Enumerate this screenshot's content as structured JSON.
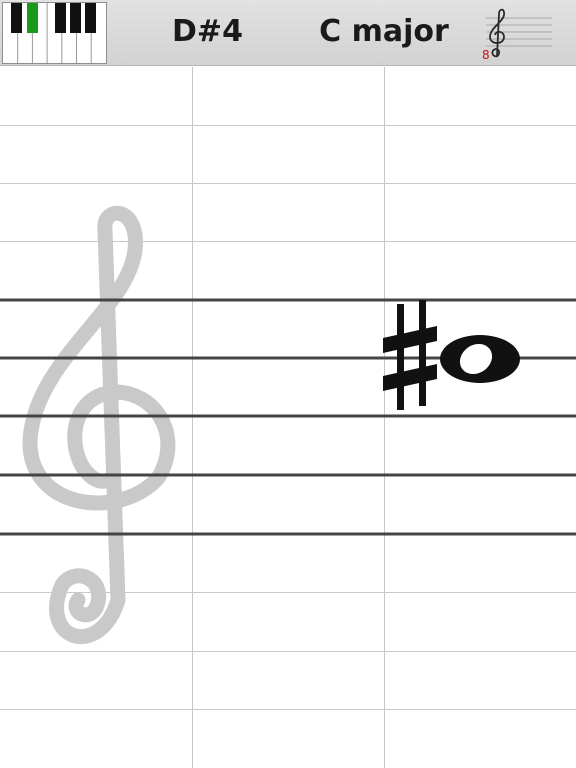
{
  "header": {
    "note": "D#4",
    "key": "C major",
    "clef_octave_marker": "8"
  },
  "keyboard_icon": {
    "name": "piano-keyboard-icon",
    "highlight_color": "#1a9a1a"
  },
  "clef_selector_icon": "treble-clef-icon",
  "staff": {
    "clef": "treble-clef",
    "notes": [
      {
        "accidental": "sharp",
        "type": "whole-note"
      }
    ]
  },
  "colors": {
    "header_bg": "#d9d9d9",
    "grid_line": "#c8c8c8",
    "staff_line": "#444444",
    "clef_watermark": "#c9c9c9",
    "octave_marker": "#d01010"
  }
}
